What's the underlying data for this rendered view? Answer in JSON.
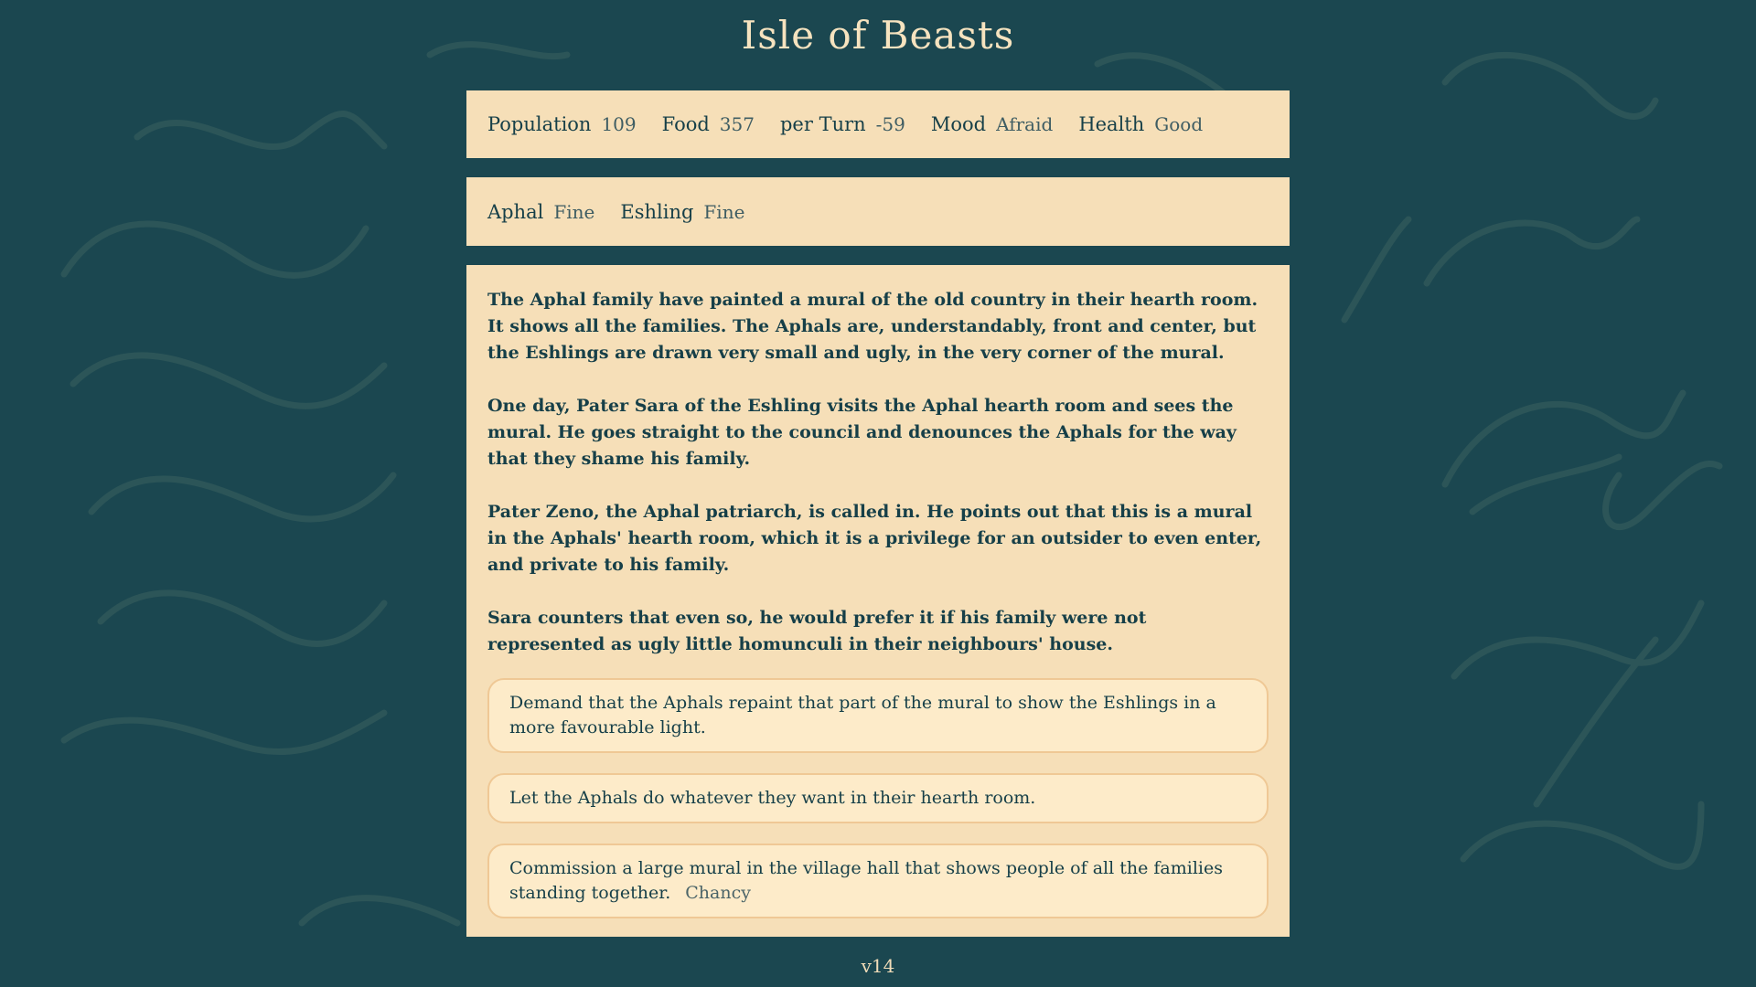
{
  "header": {
    "title": "Isle of Beasts"
  },
  "stats": [
    {
      "label": "Population",
      "value": "109"
    },
    {
      "label": "Food",
      "value": "357"
    },
    {
      "label": "per Turn",
      "value": "-59"
    },
    {
      "label": "Mood",
      "value": "Afraid"
    },
    {
      "label": "Health",
      "value": "Good"
    }
  ],
  "families": [
    {
      "label": "Aphal",
      "value": "Fine"
    },
    {
      "label": "Eshling",
      "value": "Fine"
    }
  ],
  "story": {
    "paragraphs": [
      "The Aphal family have painted a mural of the old country in their hearth room. It shows all the families. The Aphals are, understandably, front and center, but the Eshlings are drawn very small and ugly, in the very corner of the mural.",
      "One day, Pater Sara of the Eshling visits the Aphal hearth room and sees the mural. He goes straight to the council and denounces the Aphals for the way that they shame his family.",
      "Pater Zeno, the Aphal patriarch, is called in. He points out that this is a mural in the Aphals' hearth room, which it is a privilege for an outsider to even enter, and private to his family.",
      "Sara counters that even so, he would prefer it if his family were not represented as ugly little homunculi in their neighbours' house."
    ]
  },
  "choices": [
    {
      "text": "Demand that the Aphals repaint that part of the mural to show the Eshlings in a more favourable light.",
      "tag": ""
    },
    {
      "text": "Let the Aphals do whatever they want in their hearth room.",
      "tag": ""
    },
    {
      "text": "Commission a large mural in the village hall that shows people of all the families standing together.",
      "tag": "Chancy"
    }
  ],
  "footer": {
    "version": "v14"
  },
  "colors": {
    "background": "#1b4750",
    "panel": "#f6dfb8",
    "choice": "#fdebc9",
    "text": "#163f48"
  }
}
